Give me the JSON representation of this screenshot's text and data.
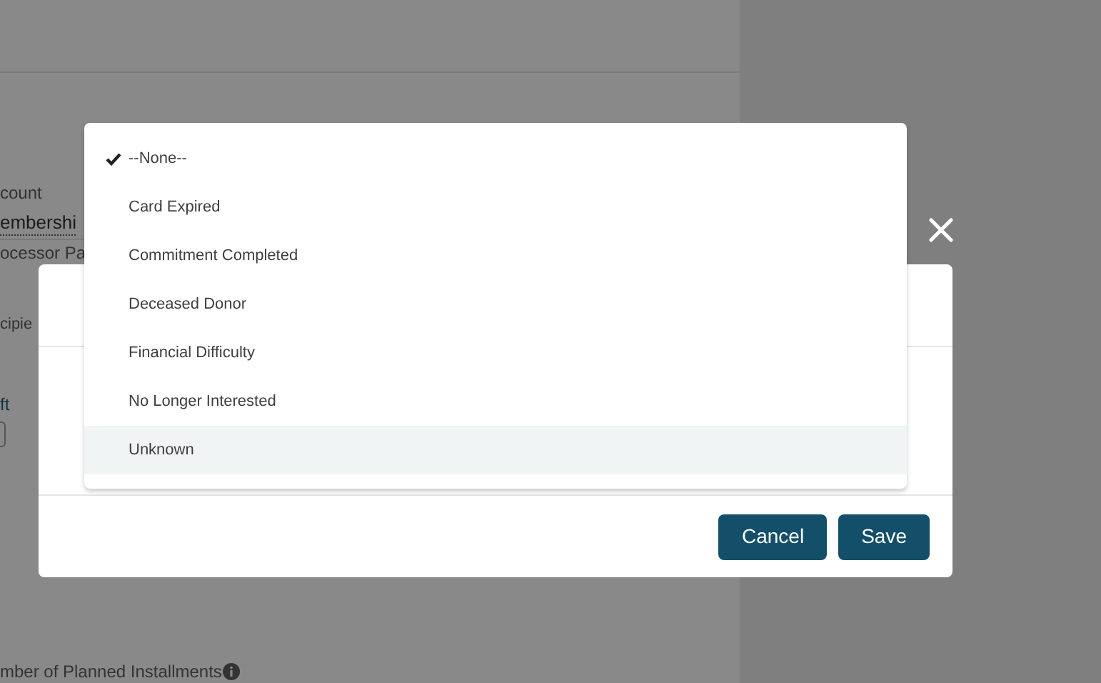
{
  "background": {
    "field_label_1": "count",
    "field_value_1": "embershi",
    "field_label_2": "ocessor Pa",
    "field_label_3": "cipie",
    "field_label_4": "ft",
    "installments_label": "mber of Planned Installments"
  },
  "dialog": {
    "buttons": [
      {
        "label": "Cancel"
      },
      {
        "label": "Save"
      }
    ]
  },
  "dropdown": {
    "options": [
      {
        "label": "--None--",
        "selected": true,
        "highlighted": false
      },
      {
        "label": "Card Expired",
        "selected": false,
        "highlighted": false
      },
      {
        "label": "Commitment Completed",
        "selected": false,
        "highlighted": false
      },
      {
        "label": "Deceased Donor",
        "selected": false,
        "highlighted": false
      },
      {
        "label": "Financial Difficulty",
        "selected": false,
        "highlighted": false
      },
      {
        "label": "No Longer Interested",
        "selected": false,
        "highlighted": false
      },
      {
        "label": "Unknown",
        "selected": false,
        "highlighted": true
      }
    ]
  }
}
